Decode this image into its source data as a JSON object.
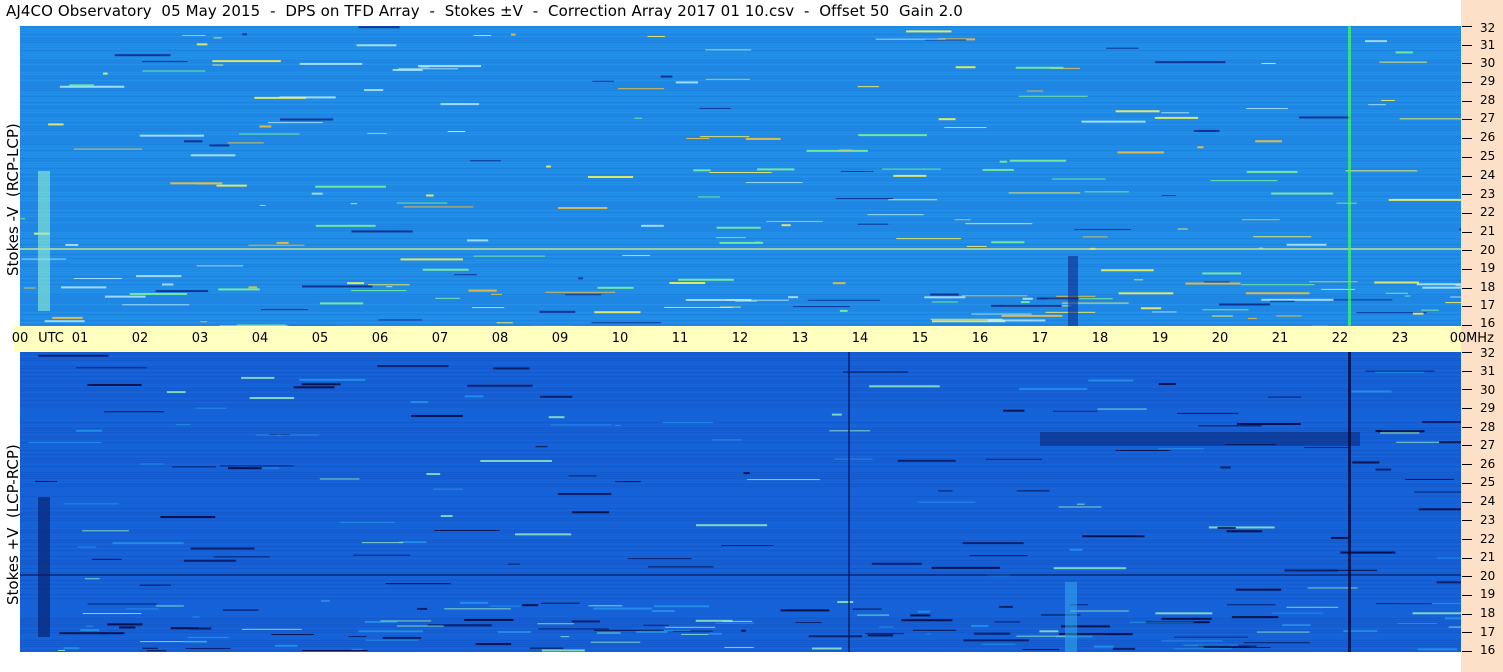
{
  "title": "AJ4CO Observatory  05 May 2015  -  DPS on TFD Array  -  Stokes ±V  -  Correction Array 2017 01 10.csv  -  Offset 50  Gain 2.0",
  "colors": {
    "top_panel": "#1f8ae6",
    "bottom_panel": "#1560d8",
    "time_strip": "#ffffc0",
    "freq_column": "#fde0c8"
  },
  "chart_data": [
    {
      "type": "heatmap",
      "ylabel": "Stokes -V  (RCP-LCP)",
      "xlim": [
        0,
        24
      ],
      "ylim": [
        16,
        32
      ],
      "yticks": [
        "32",
        "31",
        "30",
        "29",
        "28",
        "27",
        "26",
        "25",
        "24",
        "23",
        "22",
        "21",
        "20",
        "19",
        "18",
        "17",
        "16"
      ]
    },
    {
      "type": "heatmap",
      "ylabel": "Stokes +V  (LCP-RCP)",
      "xlim": [
        0,
        24
      ],
      "ylim": [
        16,
        32
      ],
      "yticks": [
        "32",
        "31",
        "30",
        "29",
        "28",
        "27",
        "26",
        "25",
        "24",
        "23",
        "22",
        "21",
        "20",
        "19",
        "18",
        "17",
        "16"
      ]
    }
  ],
  "time_axis": {
    "labels": [
      "00",
      "UTC",
      "01",
      "02",
      "03",
      "04",
      "05",
      "06",
      "07",
      "08",
      "09",
      "10",
      "11",
      "12",
      "13",
      "14",
      "15",
      "16",
      "17",
      "18",
      "19",
      "20",
      "21",
      "22",
      "23",
      "00",
      "MHz"
    ]
  }
}
